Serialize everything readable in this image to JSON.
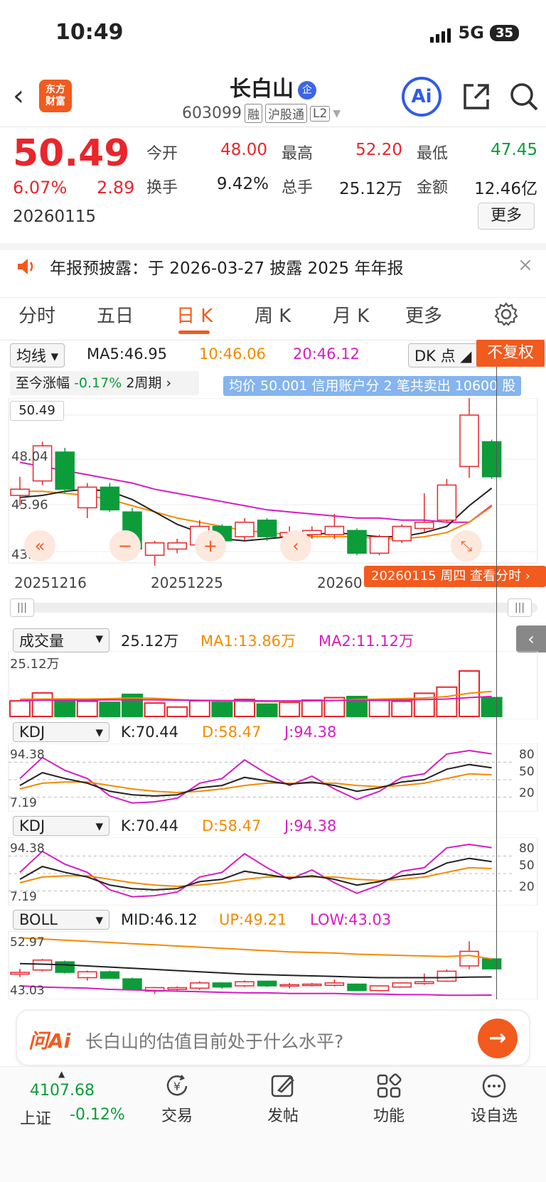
{
  "status_bar": {
    "time": "10:49",
    "network": "5G",
    "battery": "35"
  },
  "header": {
    "logo_text_1": "东方",
    "logo_text_2": "财富",
    "stock_name": "长白山",
    "ent_badge": "企",
    "stock_code": "603099",
    "tag_rong": "融",
    "tag_hgt": "沪股通",
    "tag_level": "L2",
    "ai_label": "Ai"
  },
  "quote": {
    "price": "50.49",
    "change_pct": "6.07%",
    "change": "2.89",
    "date": "20260115",
    "open_label": "今开",
    "open": "48.00",
    "high_label": "最高",
    "high": "52.20",
    "low_label": "最低",
    "low": "47.45",
    "turnover_label": "换手",
    "turnover": "9.42%",
    "volume_label": "总手",
    "volume": "25.12万",
    "amount_label": "金额",
    "amount": "12.46亿",
    "more_label": "更多"
  },
  "notice": {
    "text": "年报预披露：于 2026-03-27 披露 2025 年年报",
    "close": "×"
  },
  "tabs": [
    "分时",
    "五日",
    "日 K",
    "周 K",
    "月 K",
    "更多"
  ],
  "active_tab": "日 K",
  "chart_header": {
    "ma_select": "均线",
    "ma5": "MA5:46.95",
    "ma10": "10:46.06",
    "ma20": "20:46.12",
    "dk_select": "DK 点",
    "fuquan": "不复权",
    "range_label": "至今涨幅",
    "range_value": "-0.17%",
    "range_period": "2周期",
    "avg_banner": "均价 50.001 信用账户分 2 笔共卖出 10600 股"
  },
  "kline_axis": {
    "price_top": "50.49",
    "price_mid": "48.04",
    "price_lower": "45.96",
    "price_bottom": "43.88",
    "date_1": "20251216",
    "date_2": "20251225",
    "date_3": "20260",
    "date_tag": "20260115 周四  查看分时  ›"
  },
  "volume_panel": {
    "select": "成交量",
    "value": "25.12万",
    "ma1": "MA1:13.86万",
    "ma2": "MA2:11.12万",
    "top": "25.12万"
  },
  "kdj_panel_1": {
    "select": "KDJ",
    "k": "K:70.44",
    "d": "D:58.47",
    "j": "J:94.38",
    "top": "94.38",
    "bottom": "7.19",
    "l80": "80",
    "l50": "50",
    "l20": "20"
  },
  "kdj_panel_2": {
    "select": "KDJ",
    "k": "K:70.44",
    "d": "D:58.47",
    "j": "J:94.38",
    "top": "94.38",
    "bottom": "7.19",
    "l80": "80",
    "l50": "50",
    "l20": "20"
  },
  "boll_panel": {
    "select": "BOLL",
    "mid": "MID:46.12",
    "up": "UP:49.21",
    "low": "LOW:43.03",
    "top": "52.97",
    "bottom": "43.03"
  },
  "ask_ai": {
    "logo": "问Ai",
    "placeholder": "长白山的估值目前处于什么水平?"
  },
  "bottom_nav": {
    "index_value": "4107.68",
    "index_name": "上证",
    "index_change": "-0.12%",
    "items": [
      "交易",
      "发帖",
      "功能",
      "设自选"
    ]
  },
  "colors": {
    "up": "#e8262c",
    "down": "#0d9c3a",
    "accent": "#f25a1e",
    "ma10": "#f28a00",
    "ma20": "#d61dc0"
  },
  "chart_data": {
    "type": "candlestick",
    "candles": [
      {
        "o": 46.6,
        "c": 46.9,
        "h": 47.5,
        "l": 46.1
      },
      {
        "o": 47.3,
        "c": 49.0,
        "h": 49.2,
        "l": 47.1
      },
      {
        "o": 48.7,
        "c": 46.9,
        "h": 48.9,
        "l": 46.7
      },
      {
        "o": 46.0,
        "c": 47.0,
        "h": 47.2,
        "l": 45.5
      },
      {
        "o": 47.0,
        "c": 45.9,
        "h": 47.2,
        "l": 45.8
      },
      {
        "o": 45.8,
        "c": 44.0,
        "h": 46.0,
        "l": 43.8
      },
      {
        "o": 43.7,
        "c": 44.3,
        "h": 44.4,
        "l": 43.2
      },
      {
        "o": 44.0,
        "c": 44.3,
        "h": 44.5,
        "l": 43.8
      },
      {
        "o": 44.2,
        "c": 45.1,
        "h": 45.4,
        "l": 43.9
      },
      {
        "o": 45.1,
        "c": 44.4,
        "h": 45.2,
        "l": 44.1
      },
      {
        "o": 44.6,
        "c": 45.3,
        "h": 45.5,
        "l": 44.4
      },
      {
        "o": 45.4,
        "c": 44.6,
        "h": 45.5,
        "l": 44.4
      },
      {
        "o": 44.6,
        "c": 44.8,
        "h": 45.1,
        "l": 44.2
      },
      {
        "o": 44.7,
        "c": 44.9,
        "h": 45.1,
        "l": 44.5
      },
      {
        "o": 44.7,
        "c": 45.1,
        "h": 45.7,
        "l": 44.5
      },
      {
        "o": 44.9,
        "c": 43.8,
        "h": 45.0,
        "l": 43.7
      },
      {
        "o": 43.8,
        "c": 44.6,
        "h": 44.7,
        "l": 43.7
      },
      {
        "o": 44.4,
        "c": 45.1,
        "h": 45.2,
        "l": 44.3
      },
      {
        "o": 45.0,
        "c": 45.3,
        "h": 46.7,
        "l": 44.8
      },
      {
        "o": 45.4,
        "c": 47.1,
        "h": 47.4,
        "l": 45.3
      },
      {
        "o": 48.0,
        "c": 50.49,
        "h": 52.2,
        "l": 47.45
      },
      {
        "o": 49.2,
        "c": 47.5,
        "h": 49.3,
        "l": 47.4
      }
    ],
    "ma5": [
      46.5,
      46.6,
      46.8,
      46.9,
      46.8,
      46.4,
      45.8,
      45.2,
      44.8,
      44.5,
      44.4,
      44.5,
      44.6,
      44.7,
      44.8,
      44.7,
      44.6,
      44.6,
      44.8,
      45.1,
      46.1,
      46.95
    ],
    "ma10": [
      46.8,
      46.8,
      46.7,
      46.6,
      46.4,
      46.1,
      45.8,
      45.5,
      45.3,
      45.1,
      44.9,
      44.8,
      44.7,
      44.6,
      44.6,
      44.6,
      44.5,
      44.5,
      44.6,
      44.8,
      45.3,
      46.06
    ],
    "ma20": [
      48.2,
      48.0,
      47.8,
      47.6,
      47.4,
      47.2,
      46.9,
      46.7,
      46.5,
      46.3,
      46.1,
      45.9,
      45.8,
      45.7,
      45.6,
      45.5,
      45.5,
      45.4,
      45.4,
      45.3,
      45.3,
      46.12
    ],
    "ylim": [
      43.88,
      50.49
    ],
    "volume": [
      {
        "v": 8.6,
        "up": true
      },
      {
        "v": 13.0,
        "up": true
      },
      {
        "v": 9.4,
        "up": false
      },
      {
        "v": 8.4,
        "up": true
      },
      {
        "v": 7.8,
        "up": false
      },
      {
        "v": 12.2,
        "up": false
      },
      {
        "v": 7.4,
        "up": true
      },
      {
        "v": 5.2,
        "up": true
      },
      {
        "v": 8.6,
        "up": true
      },
      {
        "v": 7.8,
        "up": false
      },
      {
        "v": 9.4,
        "up": true
      },
      {
        "v": 6.8,
        "up": false
      },
      {
        "v": 7.8,
        "up": true
      },
      {
        "v": 9.0,
        "up": true
      },
      {
        "v": 10.4,
        "up": true
      },
      {
        "v": 11.0,
        "up": false
      },
      {
        "v": 8.8,
        "up": true
      },
      {
        "v": 8.4,
        "up": true
      },
      {
        "v": 12.8,
        "up": true
      },
      {
        "v": 16.2,
        "up": true
      },
      {
        "v": 25.12,
        "up": true
      },
      {
        "v": 10.4,
        "up": false
      }
    ],
    "vol_ma1": [
      9.5,
      9.6,
      9.7,
      9.6,
      9.8,
      10.2,
      10.0,
      9.4,
      8.8,
      8.6,
      8.4,
      8.2,
      8.4,
      8.6,
      8.8,
      9.4,
      9.6,
      9.8,
      10.2,
      11.0,
      12.8,
      13.86
    ],
    "vol_ma2": [
      8.8,
      8.9,
      9.0,
      9.0,
      9.1,
      9.2,
      9.2,
      9.0,
      8.9,
      8.8,
      8.7,
      8.6,
      8.6,
      8.7,
      8.8,
      8.9,
      9.0,
      9.1,
      9.3,
      9.6,
      10.4,
      11.12
    ],
    "kdj_k": [
      40,
      62,
      52,
      44,
      30,
      24,
      22,
      24,
      36,
      40,
      54,
      48,
      42,
      46,
      40,
      30,
      36,
      46,
      50,
      68,
      76,
      70.44
    ],
    "kdj_d": [
      34,
      44,
      46,
      46,
      40,
      34,
      30,
      28,
      30,
      34,
      40,
      44,
      44,
      44,
      44,
      40,
      38,
      40,
      44,
      52,
      60,
      58.47
    ],
    "kdj_j": [
      52,
      88,
      66,
      52,
      22,
      10,
      12,
      18,
      44,
      52,
      84,
      60,
      40,
      56,
      34,
      16,
      30,
      54,
      60,
      94,
      100,
      94.38
    ],
    "boll_up": [
      52.8,
      52.6,
      52.4,
      52.2,
      52.0,
      51.8,
      51.6,
      51.4,
      51.2,
      51.0,
      50.8,
      50.6,
      50.4,
      50.3,
      50.2,
      50.0,
      49.9,
      49.8,
      49.7,
      49.6,
      49.8,
      49.21
    ],
    "boll_mid": [
      48.4,
      48.3,
      48.2,
      48.0,
      47.8,
      47.6,
      47.4,
      47.2,
      47.0,
      46.8,
      46.6,
      46.5,
      46.4,
      46.3,
      46.2,
      46.1,
      46.0,
      46.0,
      46.0,
      46.0,
      46.1,
      46.12
    ],
    "boll_low": [
      44.6,
      44.4,
      44.3,
      44.2,
      44.0,
      43.9,
      43.8,
      43.7,
      43.6,
      43.5,
      43.4,
      43.4,
      43.3,
      43.3,
      43.3,
      43.2,
      43.2,
      43.1,
      43.1,
      43.0,
      43.0,
      43.03
    ],
    "boll_ylim": [
      43.03,
      52.97
    ]
  }
}
